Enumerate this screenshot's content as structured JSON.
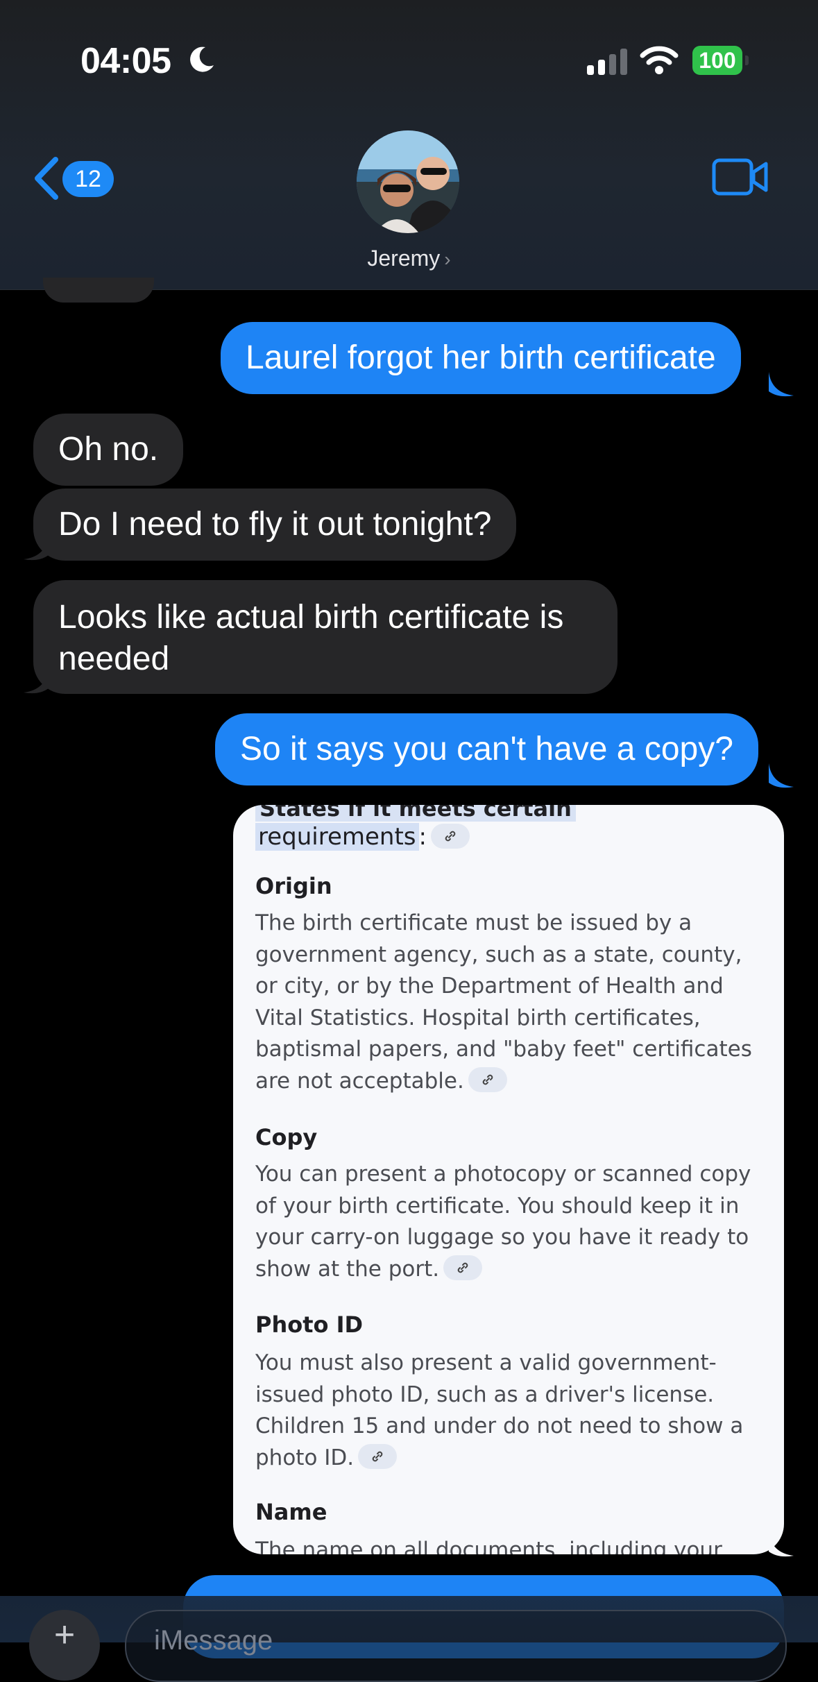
{
  "status_bar": {
    "time": "04:05",
    "battery": "100"
  },
  "header": {
    "back_count": "12",
    "contact_name": "Jeremy"
  },
  "messages": [
    {
      "from": "me",
      "text": "Laurel forgot her birth certificate"
    },
    {
      "from": "them",
      "text": "Oh no."
    },
    {
      "from": "them",
      "text": "Do I need to fly it out tonight?"
    },
    {
      "from": "them",
      "text": "Looks like actual birth certificate is needed"
    },
    {
      "from": "me",
      "text": "So it says you can't have a copy?"
    }
  ],
  "screenshot": {
    "clip_top": "States if it meets certain",
    "req_text": "requirements",
    "req_colon": ":",
    "sections": [
      {
        "title": "Origin",
        "text": "The birth certificate must be issued by a government agency, such as a state, county, or city, or by the Department of Health and Vital Statistics. Hospital birth certificates, baptismal papers, and \"baby feet\" certificates are not acceptable."
      },
      {
        "title": "Copy",
        "text": "You can present a photocopy or scanned copy of your birth certificate. You should keep it in your carry-on luggage so you have it ready to show at the port."
      },
      {
        "title": "Photo ID",
        "text": "You must also present a valid government-issued photo ID, such as a driver's license. Children 15 and under do not need to show a photo ID."
      },
      {
        "title": "Name",
        "text": "The name on all documents, including your"
      }
    ]
  },
  "composer": {
    "placeholder": "iMessage"
  },
  "colors": {
    "sent": "#1e84f5",
    "received": "#262628",
    "accent": "#1e8af6"
  },
  "icons": {
    "back": "chevron-left-icon",
    "video": "video-camera-icon",
    "moon": "moon-icon",
    "wifi": "wifi-icon",
    "signal": "cellular-signal-icon",
    "link": "link-icon",
    "plus": "plus-icon"
  }
}
